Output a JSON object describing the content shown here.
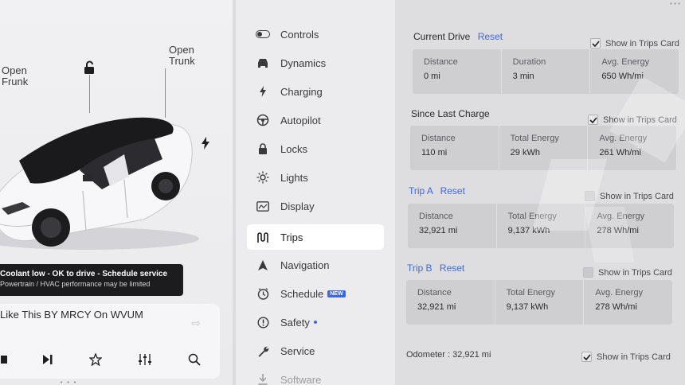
{
  "car": {
    "frunk_label": "Open\nFrunk",
    "trunk_label": "Open\nTrunk",
    "alert_title": "Coolant low - OK to drive - Schedule service",
    "alert_detail": "Powertrain / HVAC performance may be limited"
  },
  "media": {
    "song": "Like This BY MRCY On WVUM",
    "controls": [
      "stop-icon",
      "skip-next-icon",
      "favorite-star-icon",
      "equalizer-icon",
      "search-icon"
    ]
  },
  "menu": {
    "items": [
      {
        "label": "Controls",
        "icon": "toggle-icon"
      },
      {
        "label": "Dynamics",
        "icon": "car-icon"
      },
      {
        "label": "Charging",
        "icon": "bolt-icon"
      },
      {
        "label": "Autopilot",
        "icon": "steering-wheel-icon"
      },
      {
        "label": "Locks",
        "icon": "lock-icon"
      },
      {
        "label": "Lights",
        "icon": "sun-icon"
      },
      {
        "label": "Display",
        "icon": "display-icon"
      },
      {
        "label": "Trips",
        "icon": "trips-icon",
        "active": true
      },
      {
        "label": "Navigation",
        "icon": "navigation-icon"
      },
      {
        "label": "Schedule",
        "icon": "clock-icon",
        "badge": "NEW"
      },
      {
        "label": "Safety",
        "icon": "safety-icon"
      },
      {
        "label": "Service",
        "icon": "wrench-icon"
      },
      {
        "label": "Software",
        "icon": "download-icon"
      }
    ]
  },
  "trips": {
    "show_label": "Show in Trips Card",
    "reset_label": "Reset",
    "current_drive": {
      "title": "Current Drive",
      "show_checked": true,
      "stats": [
        {
          "label": "Distance",
          "value": "0 mi"
        },
        {
          "label": "Duration",
          "value": "3 min"
        },
        {
          "label": "Avg. Energy",
          "value": "650 Wh/mi"
        }
      ]
    },
    "since_last_charge": {
      "title": "Since Last Charge",
      "show_checked": true,
      "stats": [
        {
          "label": "Distance",
          "value": "110 mi"
        },
        {
          "label": "Total Energy",
          "value": "29 kWh"
        },
        {
          "label": "Avg. Energy",
          "value": "261 Wh/mi"
        }
      ]
    },
    "trip_a": {
      "title": "Trip A",
      "show_checked": false,
      "stats": [
        {
          "label": "Distance",
          "value": "32,921 mi"
        },
        {
          "label": "Total Energy",
          "value": "9,137 kWh"
        },
        {
          "label": "Avg. Energy",
          "value": "278 Wh/mi"
        }
      ]
    },
    "trip_b": {
      "title": "Trip B",
      "show_checked": false,
      "stats": [
        {
          "label": "Distance",
          "value": "32,921 mi"
        },
        {
          "label": "Total Energy",
          "value": "9,137 kWh"
        },
        {
          "label": "Avg. Energy",
          "value": "278 Wh/mi"
        }
      ]
    },
    "odometer_label": "Odometer",
    "odometer_value": "32,921 mi",
    "odometer_show_checked": true
  },
  "colors": {
    "accent": "#3e6ae1",
    "alert_bg": "#1c1c1e"
  }
}
